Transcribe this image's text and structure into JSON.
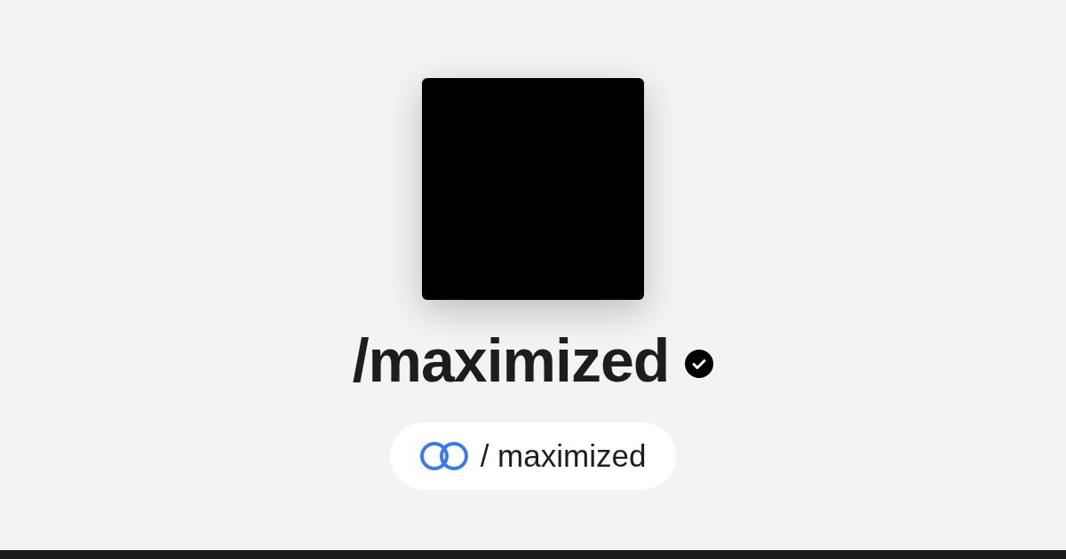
{
  "profile": {
    "name": "/maximized",
    "verified": true
  },
  "link_pill": {
    "text": "/ maximized"
  }
}
